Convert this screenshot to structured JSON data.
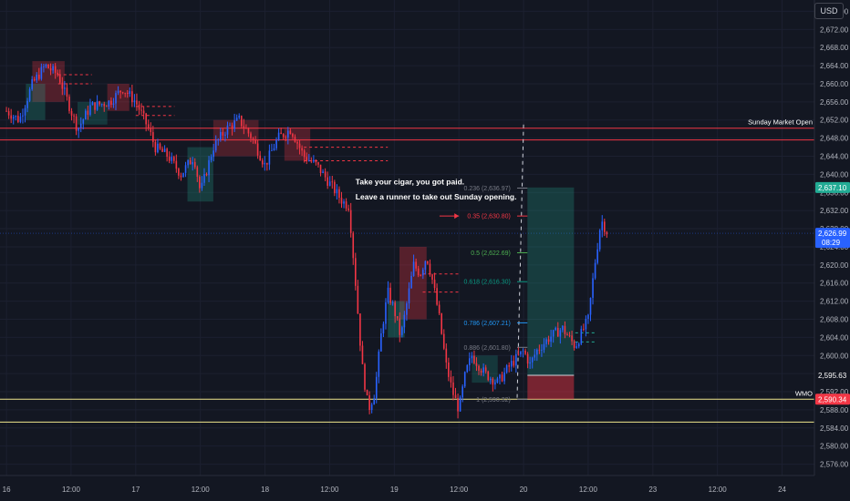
{
  "currency_button": "USD",
  "chart_data": {
    "type": "candlestick",
    "price_axis": {
      "ticks": [
        2576,
        2580,
        2584,
        2588,
        2592,
        2596,
        2600,
        2604,
        2608,
        2612,
        2616,
        2620,
        2624,
        2628,
        2632,
        2636,
        2640,
        2644,
        2648,
        2652,
        2656,
        2660,
        2664,
        2668,
        2672,
        2676
      ],
      "tick_labels": [
        "2,576.00",
        "2,580.00",
        "2,584.00",
        "2,588.00",
        "2,592.00",
        "2,596.00",
        "2,600.00",
        "2,604.00",
        "2,608.00",
        "2,612.00",
        "2,616.00",
        "2,620.00",
        "2,624.00",
        "2,628.00",
        "2,632.00",
        "2,636.00",
        "2,640.00",
        "2,644.00",
        "2,648.00",
        "2,652.00",
        "2,656.00",
        "2,660.00",
        "2,664.00",
        "2,668.00",
        "2,672.00",
        "2,676.00"
      ],
      "ylim": [
        2573.5,
        2678.5
      ]
    },
    "time_axis": {
      "tick_labels": [
        "16",
        "12:00",
        "17",
        "12:00",
        "18",
        "12:00",
        "19",
        "12:00",
        "20",
        "12:00",
        "23",
        "12:00",
        "24"
      ],
      "tick_positions": [
        0,
        0.5,
        1,
        1.5,
        2,
        2.5,
        3,
        3.5,
        4,
        4.5,
        5,
        5.5,
        6
      ],
      "xlim": [
        -0.05,
        6.25
      ]
    },
    "price_path": [
      [
        0.0,
        2654
      ],
      [
        0.1,
        2652
      ],
      [
        0.2,
        2660
      ],
      [
        0.3,
        2664
      ],
      [
        0.4,
        2662
      ],
      [
        0.5,
        2654
      ],
      [
        0.55,
        2650
      ],
      [
        0.65,
        2655
      ],
      [
        0.8,
        2656
      ],
      [
        0.9,
        2659
      ],
      [
        1.0,
        2656
      ],
      [
        1.1,
        2650
      ],
      [
        1.15,
        2646
      ],
      [
        1.25,
        2644
      ],
      [
        1.35,
        2640
      ],
      [
        1.45,
        2644
      ],
      [
        1.5,
        2636
      ],
      [
        1.6,
        2646
      ],
      [
        1.7,
        2650
      ],
      [
        1.8,
        2652
      ],
      [
        1.9,
        2648
      ],
      [
        2.0,
        2642
      ],
      [
        2.1,
        2648
      ],
      [
        2.2,
        2650
      ],
      [
        2.3,
        2644
      ],
      [
        2.4,
        2642
      ],
      [
        2.5,
        2638
      ],
      [
        2.6,
        2634
      ],
      [
        2.65,
        2633
      ],
      [
        2.7,
        2616
      ],
      [
        2.75,
        2598
      ],
      [
        2.8,
        2588
      ],
      [
        2.85,
        2592
      ],
      [
        2.9,
        2605
      ],
      [
        2.95,
        2614
      ],
      [
        3.0,
        2610
      ],
      [
        3.05,
        2604
      ],
      [
        3.1,
        2612
      ],
      [
        3.15,
        2620
      ],
      [
        3.2,
        2618
      ],
      [
        3.25,
        2622
      ],
      [
        3.3,
        2616
      ],
      [
        3.35,
        2608
      ],
      [
        3.4,
        2598
      ],
      [
        3.45,
        2592
      ],
      [
        3.5,
        2588
      ],
      [
        3.55,
        2596
      ],
      [
        3.6,
        2600
      ],
      [
        3.7,
        2596
      ],
      [
        3.8,
        2594
      ],
      [
        3.9,
        2598
      ],
      [
        4.0,
        2601
      ],
      [
        4.05,
        2598
      ],
      [
        4.1,
        2601
      ],
      [
        4.2,
        2604
      ],
      [
        4.3,
        2606
      ],
      [
        4.4,
        2602
      ],
      [
        4.5,
        2608
      ],
      [
        4.55,
        2620
      ],
      [
        4.6,
        2630
      ],
      [
        4.65,
        2626.99
      ]
    ],
    "current_price": {
      "value": 2626.99,
      "label": "2,626.99",
      "countdown": "08:29"
    },
    "price_tags": [
      {
        "value": 2637.1,
        "label": "2,637.10",
        "color": "#22ab94"
      },
      {
        "value": 2595.63,
        "label": "2,595.63",
        "color": "#131722"
      },
      {
        "value": 2590.34,
        "label": "2,590.34",
        "color": "#f23645"
      }
    ],
    "horizontal_lines": [
      {
        "name": "Sunday Market Open",
        "value": 2650.2,
        "color": "#f23645"
      },
      {
        "name": "",
        "value": 2647.6,
        "color": "#f23645"
      },
      {
        "name": "WMO",
        "value": 2590.34,
        "color": "#f0e68c"
      },
      {
        "name": "",
        "value": 2585.3,
        "color": "#f0e68c"
      }
    ],
    "fib_levels": [
      {
        "ratio": "0.236",
        "price": "2,636.97",
        "value": 2636.97,
        "color": "#787b86"
      },
      {
        "ratio": "0.35",
        "price": "2,630.80",
        "value": 2630.8,
        "color": "#f23645"
      },
      {
        "ratio": "0.5",
        "price": "2,622.69",
        "value": 2622.69,
        "color": "#4caf50"
      },
      {
        "ratio": "0.618",
        "price": "2,616.30",
        "value": 2616.3,
        "color": "#089981"
      },
      {
        "ratio": "0.786",
        "price": "2,607.21",
        "value": 2607.21,
        "color": "#2196f3"
      },
      {
        "ratio": "0.886",
        "price": "2,601.80",
        "value": 2601.8,
        "color": "#787b86"
      },
      {
        "ratio": "1",
        "price": "2,590.32",
        "value": 2590.32,
        "color": "#787b86"
      }
    ],
    "position_tool": {
      "x_start": 4.03,
      "x_end": 4.39,
      "entry": 2595.63,
      "target": 2637.1,
      "stop": 2590.34
    },
    "annotations": [
      "Take your cigar, you got paid.",
      "Leave a runner to take out Sunday opening."
    ]
  }
}
